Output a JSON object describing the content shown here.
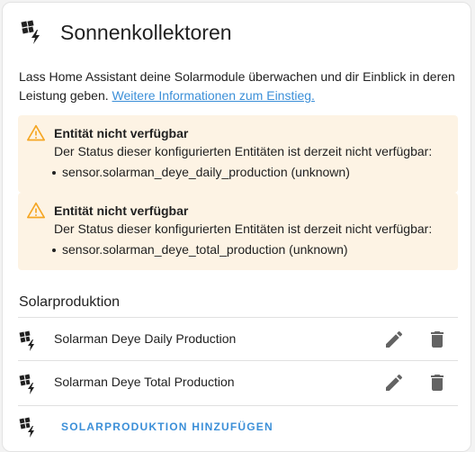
{
  "card": {
    "title": "Sonnenkollektoren",
    "header_icon": "solar-power-icon",
    "description": "Lass Home Assistant deine Solarmodule überwachen und dir Einblick in deren Leistung geben.",
    "link_text": "Weitere Informationen zum Einstieg."
  },
  "warnings": [
    {
      "title": "Entität nicht verfügbar",
      "text": "Der Status dieser konfigurierten Entitäten ist derzeit nicht verfügbar:",
      "item": "sensor.solarman_deye_daily_production (unknown)",
      "icon": "alert-icon",
      "color": "#f5a623"
    },
    {
      "title": "Entität nicht verfügbar",
      "text": "Der Status dieser konfigurierten Entitäten ist derzeit nicht verfügbar:",
      "item": "sensor.solarman_deye_total_production (unknown)",
      "icon": "alert-icon",
      "color": "#f5a623"
    }
  ],
  "section": {
    "title": "Solarproduktion",
    "rows": [
      {
        "label": "Solarman Deye Daily Production",
        "icon": "solar-power-icon"
      },
      {
        "label": "Solarman Deye Total Production",
        "icon": "solar-power-icon"
      }
    ],
    "add_label": "SOLARPRODUKTION HINZUFÜGEN"
  },
  "colors": {
    "accent": "#3b8fd8",
    "warning_bg": "#fdf3e4",
    "icon": "#636363"
  }
}
